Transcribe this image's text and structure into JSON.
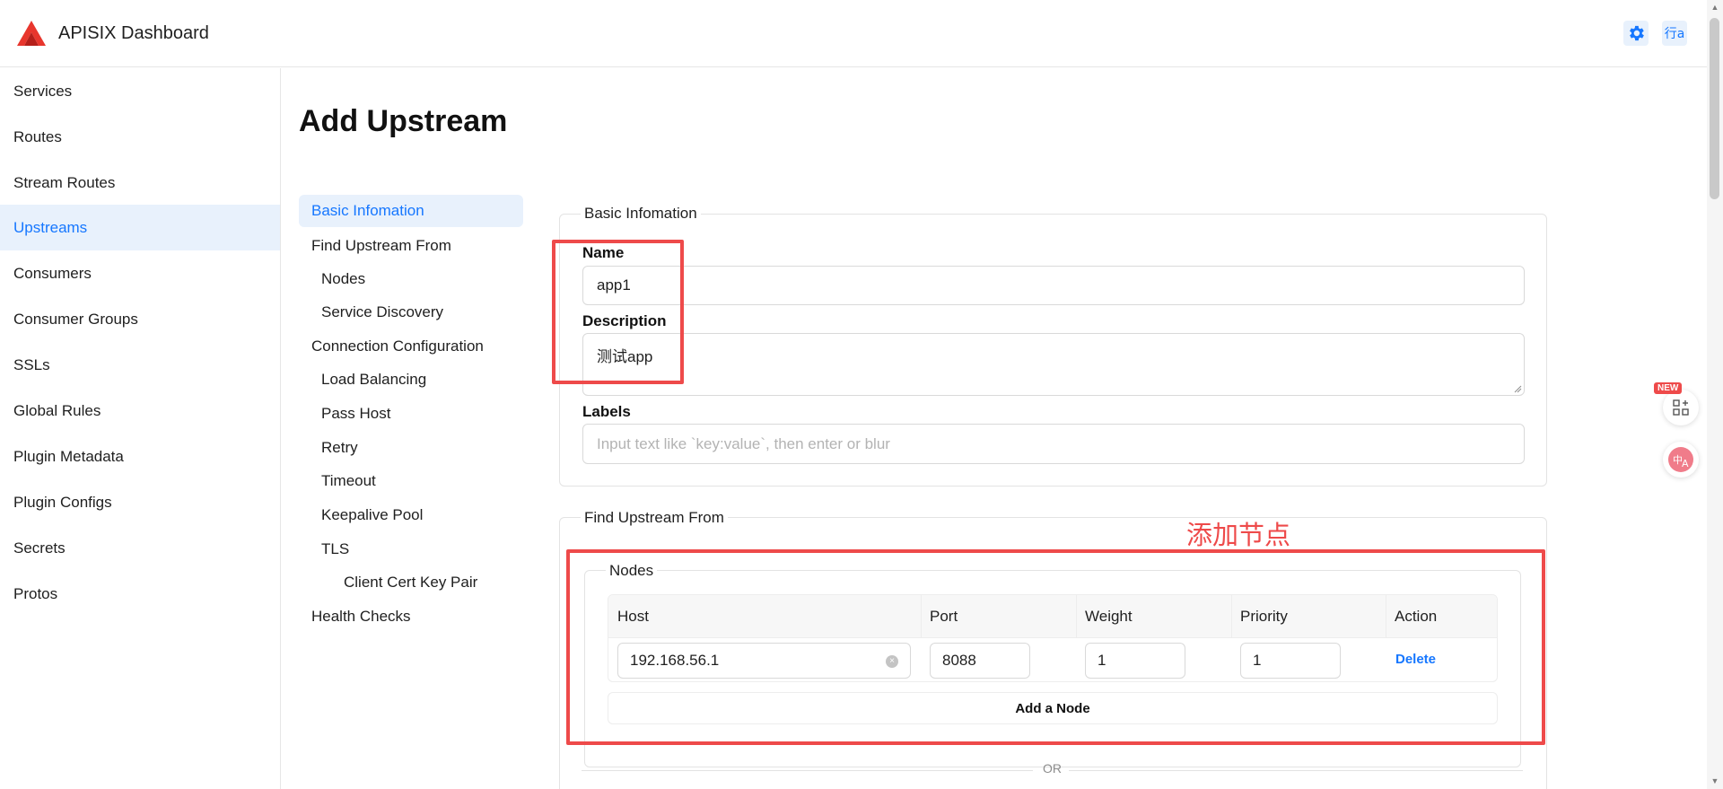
{
  "header": {
    "app_title": "APISIX Dashboard",
    "lang_label": "行a",
    "icons": [
      "apisix-logo-icon",
      "settings-icon",
      "language-icon"
    ],
    "accent_color": "#1677ff"
  },
  "sidebar": {
    "items": [
      {
        "label": "Services"
      },
      {
        "label": "Routes"
      },
      {
        "label": "Stream Routes"
      },
      {
        "label": "Upstreams",
        "active": true
      },
      {
        "label": "Consumers"
      },
      {
        "label": "Consumer Groups"
      },
      {
        "label": "SSLs"
      },
      {
        "label": "Global Rules"
      },
      {
        "label": "Plugin Metadata"
      },
      {
        "label": "Plugin Configs"
      },
      {
        "label": "Secrets"
      },
      {
        "label": "Protos"
      }
    ]
  },
  "page": {
    "title": "Add Upstream"
  },
  "anchors": [
    {
      "label": "Basic Infomation",
      "active": true
    },
    {
      "label": "Find Upstream From"
    },
    {
      "label": "Nodes"
    },
    {
      "label": "Service Discovery"
    },
    {
      "label": "Connection Configuration"
    },
    {
      "label": "Load Balancing"
    },
    {
      "label": "Pass Host"
    },
    {
      "label": "Retry"
    },
    {
      "label": "Timeout"
    },
    {
      "label": "Keepalive Pool"
    },
    {
      "label": "TLS"
    },
    {
      "label": "Client Cert Key Pair"
    },
    {
      "label": "Health Checks"
    }
  ],
  "basic_info": {
    "legend": "Basic Infomation",
    "name_label": "Name",
    "name_value": "app1",
    "description_label": "Description",
    "description_value": "测试app",
    "labels_label": "Labels",
    "labels_placeholder": "Input text like `key:value`, then enter or blur"
  },
  "find_upstream": {
    "legend": "Find Upstream From",
    "nodes_legend": "Nodes",
    "columns": [
      "Host",
      "Port",
      "Weight",
      "Priority",
      "Action"
    ],
    "rows": [
      {
        "host": "192.168.56.1",
        "port": "8088",
        "weight": "1",
        "priority": "1",
        "action": "Delete"
      }
    ],
    "add_node_label": "Add a Node",
    "or_label": "OR"
  },
  "annotation": {
    "note": "添加节点",
    "color": "#ee4a4a"
  },
  "float_widgets": {
    "new_badge": "NEW"
  }
}
